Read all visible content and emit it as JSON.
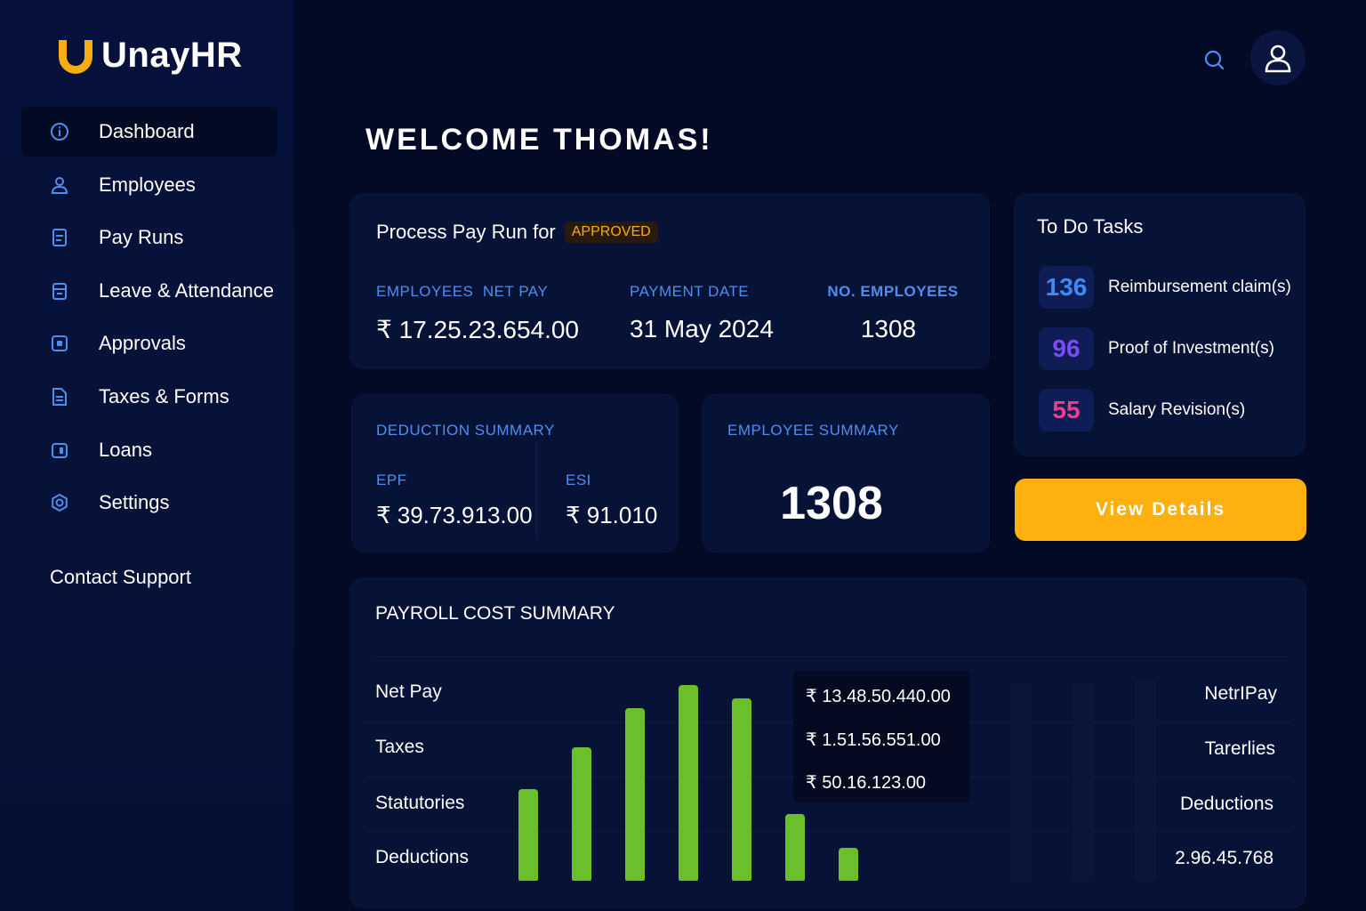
{
  "brand": {
    "name": "UnayHR",
    "accent": "#f6ad12"
  },
  "sidebar": {
    "items": [
      {
        "label": "Dashboard",
        "icon": "info-icon",
        "active": true
      },
      {
        "label": "Employees",
        "icon": "user-icon"
      },
      {
        "label": "Pay Runs",
        "icon": "document-icon"
      },
      {
        "label": "Leave & Attendance",
        "icon": "calendar-icon"
      },
      {
        "label": "Approvals",
        "icon": "approval-icon"
      },
      {
        "label": "Taxes & Forms",
        "icon": "forms-icon"
      },
      {
        "label": "Loans",
        "icon": "wallet-icon"
      },
      {
        "label": "Settings",
        "icon": "gear-icon"
      }
    ],
    "contact_label": "Contact Support"
  },
  "header": {
    "search_icon": "search-icon",
    "avatar_icon": "user-avatar-icon"
  },
  "welcome": "WELCOME THOMAS!",
  "payrun": {
    "title": "Process Pay Run for",
    "badge": "APPROVED",
    "net_pay_label": "EMPLOYEES  NET PAY",
    "net_pay": "₹ 17.25.23.654.00",
    "payment_date_label": "PAYMENT DATE",
    "payment_date": "31 May 2024",
    "employees_label": "NO. EMPLOYEES",
    "employees": "1308"
  },
  "deduction": {
    "title": "DEDUCTION SUMMARY",
    "epf_label": "EPF",
    "epf": "₹ 39.73.913.00",
    "esi_label": "ESI",
    "esi": "₹ 91.010"
  },
  "employee_summary": {
    "title": "EMPLOYEE SUMMARY",
    "count": "1308"
  },
  "todo": {
    "title": "To Do Tasks",
    "tasks": [
      {
        "count": "136",
        "label": "Reimbursement claim(s)",
        "color": "#3d8cf5"
      },
      {
        "count": "96",
        "label": "Proof of Investment(s)",
        "color": "#7a4cf2"
      },
      {
        "count": "55",
        "label": "Salary Revision(s)",
        "color": "#ee3d8f"
      }
    ],
    "button": "View Details"
  },
  "payroll": {
    "title": "PAYROLL COST SUMMARY",
    "rows": [
      "Net Pay",
      "Taxes",
      "Statutories",
      "Deductions"
    ],
    "tooltip": [
      "₹ 13.48.50.440.00",
      "₹ 1.51.56.551.00",
      "₹ 50.16.123.00"
    ],
    "right_rows": [
      "NetrIPay",
      "Tarerlies",
      "Deductions",
      "2.96.45.768"
    ],
    "bar_color": "#6abf2a",
    "bars": [
      0.47,
      0.68,
      0.88,
      1.0,
      0.93,
      0.34,
      0.17
    ]
  }
}
